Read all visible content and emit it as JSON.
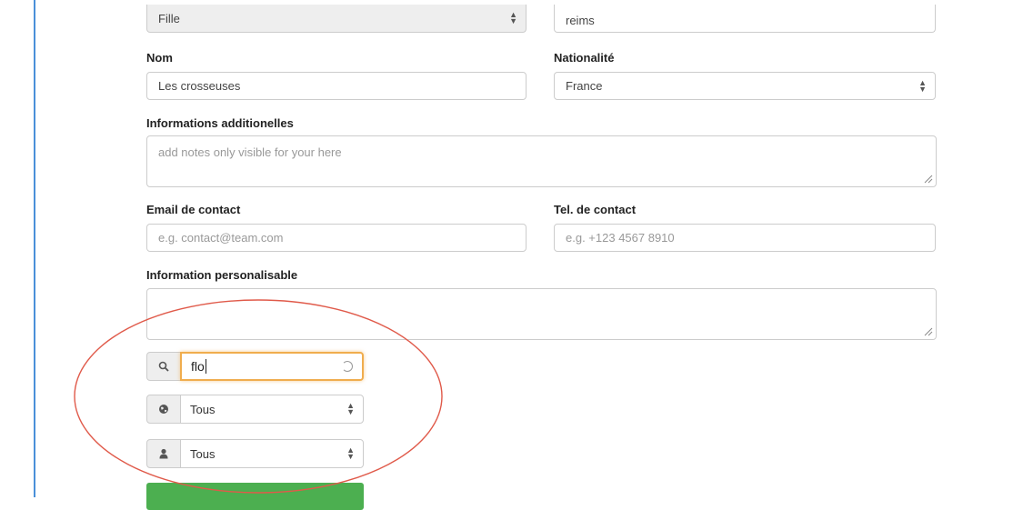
{
  "form": {
    "gender": {
      "value": "Fille"
    },
    "city": {
      "value": "reims"
    },
    "name": {
      "label": "Nom",
      "value": "Les crosseuses"
    },
    "nationality": {
      "label": "Nationalité",
      "value": "France"
    },
    "additional_info": {
      "label": "Informations additionelles",
      "placeholder": "add notes only visible for your here"
    },
    "contact_email": {
      "label": "Email de contact",
      "placeholder": "e.g. contact@team.com"
    },
    "contact_phone": {
      "label": "Tel. de contact",
      "placeholder": "e.g. +123 4567 8910"
    },
    "custom_info": {
      "label": "Information personalisable",
      "value": ""
    }
  },
  "filters": {
    "search": {
      "value": "flo",
      "icon": "search-icon"
    },
    "region": {
      "value": "Tous",
      "icon": "globe-icon"
    },
    "person": {
      "value": "Tous",
      "icon": "user-icon"
    }
  },
  "annotation": {
    "color": "#e05a4a"
  },
  "colors": {
    "focus": "#f0ad4e",
    "button": "#4caf50",
    "rule": "#4a90d9"
  }
}
